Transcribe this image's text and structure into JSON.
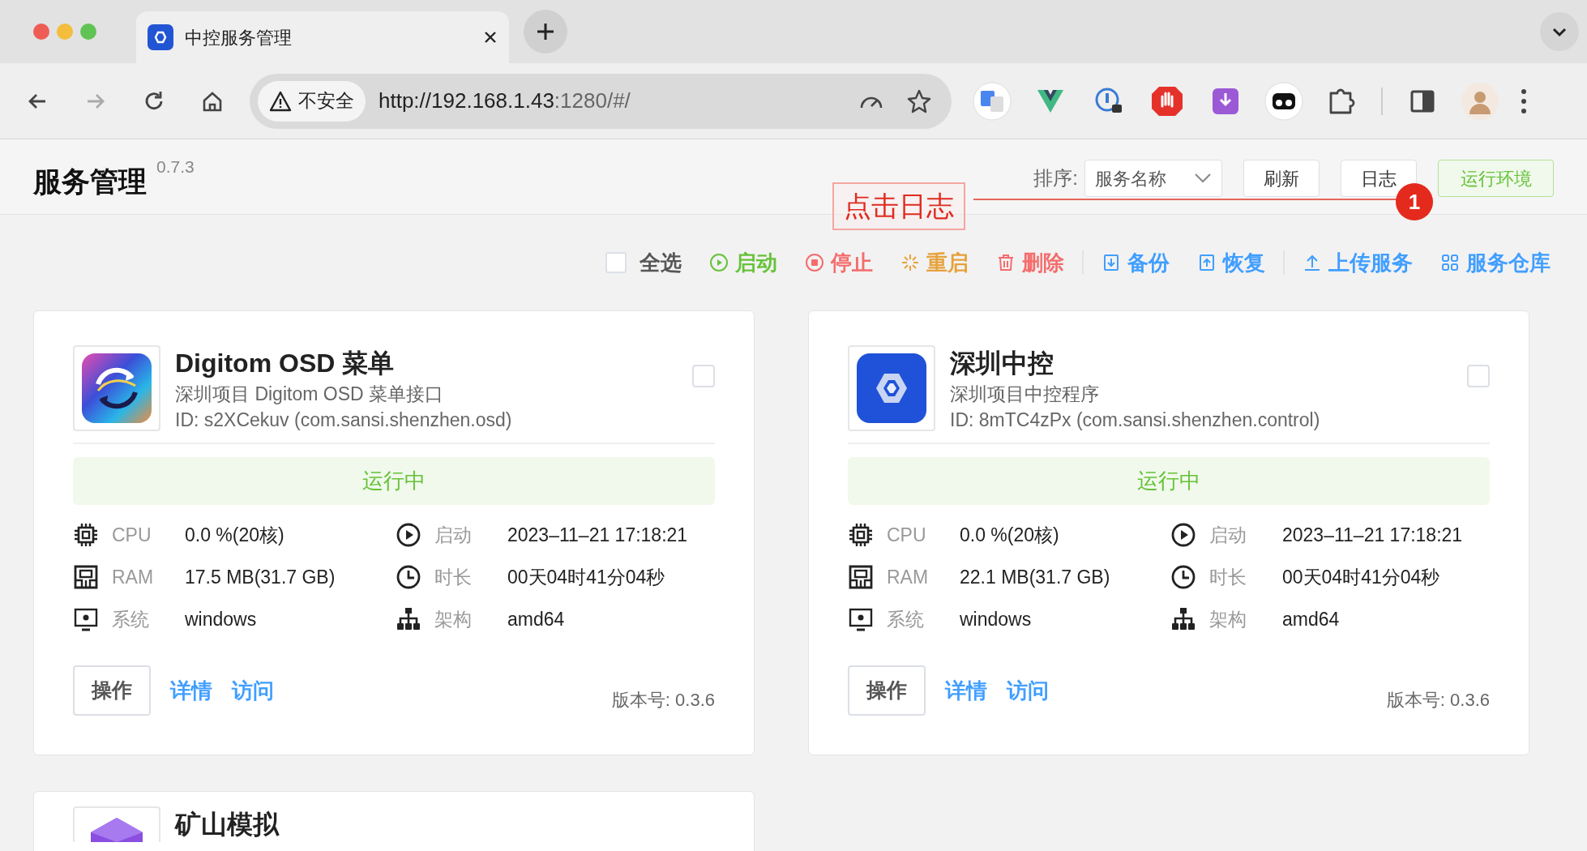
{
  "browser": {
    "tab_title": "中控服务管理",
    "url_warning": "不安全",
    "url_host": "http://192.168.1.43",
    "url_rest": ":1280/#/"
  },
  "header": {
    "title": "服务管理",
    "version": "0.7.3",
    "sort_label": "排序:",
    "sort_value": "服务名称",
    "buttons": [
      {
        "label": "刷新",
        "kind": "default"
      },
      {
        "label": "日志",
        "kind": "default"
      },
      {
        "label": "运行环境",
        "kind": "success"
      }
    ]
  },
  "annotation": {
    "text": "点击日志",
    "badge": "1"
  },
  "select_all": {
    "label": "全选",
    "checked": false
  },
  "action_groups": [
    [
      {
        "label": "启动",
        "kind": "start"
      },
      {
        "label": "停止",
        "kind": "stop"
      },
      {
        "label": "重启",
        "kind": "restart"
      },
      {
        "label": "删除",
        "kind": "delete"
      }
    ],
    [
      {
        "label": "备份",
        "kind": "backup"
      },
      {
        "label": "恢复",
        "kind": "restore"
      }
    ],
    [
      {
        "label": "上传服务",
        "kind": "upload"
      },
      {
        "label": "服务仓库",
        "kind": "store"
      }
    ]
  ],
  "services": [
    {
      "name": "Digitom OSD 菜单",
      "kind": "swirl",
      "selected": false,
      "description": "深圳项目 Digitom OSD 菜单接口",
      "id_line": "ID: s2XCekuv (com.sansi.shenzhen.osd)",
      "status": "运行中",
      "running": true,
      "stats": [
        {
          "kind": "cpu",
          "label": "CPU",
          "value": "0.0 %(20核)"
        },
        {
          "kind": "start",
          "label": "启动",
          "value": "2023–11–21 17:18:21"
        },
        {
          "kind": "ram",
          "label": "RAM",
          "value": "17.5 MB(31.7 GB)"
        },
        {
          "kind": "uptime",
          "label": "时长",
          "value": "00天04时41分04秒"
        },
        {
          "kind": "os",
          "label": "系统",
          "value": "windows"
        },
        {
          "kind": "arch",
          "label": "架构",
          "value": "amd64"
        }
      ],
      "operate": "操作",
      "links": [
        "详情",
        "访问"
      ],
      "version": "版本号: 0.3.6"
    },
    {
      "name": "深圳中控",
      "kind": "hexagon",
      "selected": false,
      "description": "深圳项目中控程序",
      "id_line": "ID: 8mTC4zPx (com.sansi.shenzhen.control)",
      "status": "运行中",
      "running": true,
      "stats": [
        {
          "kind": "cpu",
          "label": "CPU",
          "value": "0.0 %(20核)"
        },
        {
          "kind": "start",
          "label": "启动",
          "value": "2023–11–21 17:18:21"
        },
        {
          "kind": "ram",
          "label": "RAM",
          "value": "22.1 MB(31.7 GB)"
        },
        {
          "kind": "uptime",
          "label": "时长",
          "value": "00天04时41分04秒"
        },
        {
          "kind": "os",
          "label": "系统",
          "value": "windows"
        },
        {
          "kind": "arch",
          "label": "架构",
          "value": "amd64"
        }
      ],
      "operate": "操作",
      "links": [
        "详情",
        "访问"
      ],
      "version": "版本号: 0.3.6"
    },
    {
      "name": "矿山模拟",
      "kind": "cube"
    }
  ]
}
